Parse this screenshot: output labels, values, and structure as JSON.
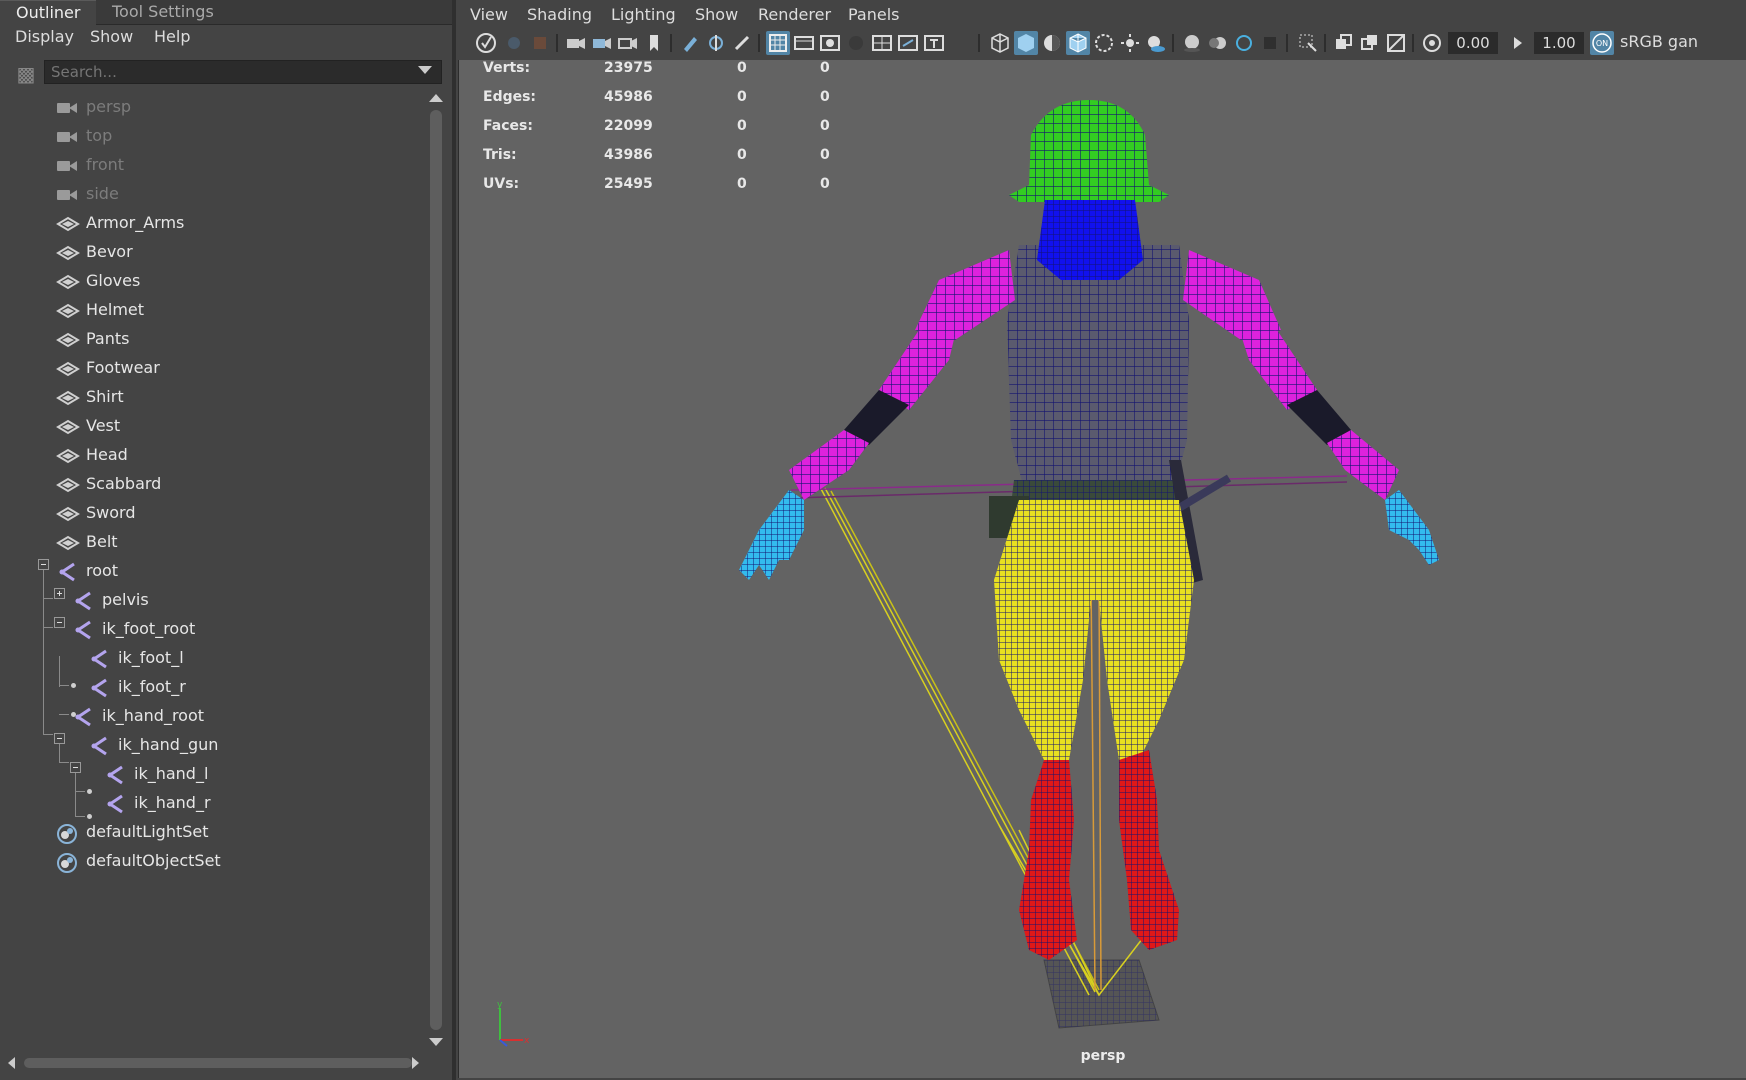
{
  "outliner": {
    "tabs": [
      "Outliner",
      "Tool Settings"
    ],
    "menu": [
      "Display",
      "Show",
      "Help"
    ],
    "search_placeholder": "Search...",
    "tree": [
      {
        "label": "persp",
        "icon": "camera-icon"
      },
      {
        "label": "top",
        "icon": "camera-icon"
      },
      {
        "label": "front",
        "icon": "camera-icon"
      },
      {
        "label": "side",
        "icon": "camera-icon"
      },
      {
        "label": "Armor_Arms",
        "icon": "mesh-icon"
      },
      {
        "label": "Bevor",
        "icon": "mesh-icon"
      },
      {
        "label": "Gloves",
        "icon": "mesh-icon"
      },
      {
        "label": "Helmet",
        "icon": "mesh-icon"
      },
      {
        "label": "Pants",
        "icon": "mesh-icon"
      },
      {
        "label": "Footwear",
        "icon": "mesh-icon"
      },
      {
        "label": "Shirt",
        "icon": "mesh-icon"
      },
      {
        "label": "Vest",
        "icon": "mesh-icon"
      },
      {
        "label": "Head",
        "icon": "mesh-icon"
      },
      {
        "label": "Scabbard",
        "icon": "mesh-icon"
      },
      {
        "label": "Sword",
        "icon": "mesh-icon"
      },
      {
        "label": "Belt",
        "icon": "mesh-icon"
      },
      {
        "label": "root",
        "icon": "joint-icon"
      },
      {
        "label": "pelvis",
        "icon": "joint-icon"
      },
      {
        "label": "ik_foot_root",
        "icon": "joint-icon"
      },
      {
        "label": "ik_foot_l",
        "icon": "joint-icon"
      },
      {
        "label": "ik_foot_r",
        "icon": "joint-icon"
      },
      {
        "label": "ik_hand_root",
        "icon": "joint-icon"
      },
      {
        "label": "ik_hand_gun",
        "icon": "joint-icon"
      },
      {
        "label": "ik_hand_l",
        "icon": "joint-icon"
      },
      {
        "label": "ik_hand_r",
        "icon": "joint-icon"
      },
      {
        "label": "defaultLightSet",
        "icon": "set-icon"
      },
      {
        "label": "defaultObjectSet",
        "icon": "set-icon"
      }
    ]
  },
  "viewport": {
    "menu": [
      "View",
      "Shading",
      "Lighting",
      "Show",
      "Renderer",
      "Panels"
    ],
    "toolbar": {
      "exposure": "0.00",
      "gamma": "1.00",
      "color_space": "sRGB gan"
    },
    "hud": [
      {
        "label": "Verts:",
        "v1": "23975",
        "v2": "0",
        "v3": "0"
      },
      {
        "label": "Edges:",
        "v1": "45986",
        "v2": "0",
        "v3": "0"
      },
      {
        "label": "Faces:",
        "v1": "22099",
        "v2": "0",
        "v3": "0"
      },
      {
        "label": "Tris:",
        "v1": "43986",
        "v2": "0",
        "v3": "0"
      },
      {
        "label": "UVs:",
        "v1": "25495",
        "v2": "0",
        "v3": "0"
      }
    ],
    "camera_label": "persp",
    "axis": {
      "y": "y",
      "x": "x"
    },
    "colors": {
      "helmet": "#33cc22",
      "bevor": "#1111ee",
      "armor_arms": "#dd22dd",
      "gloves": "#33bbee",
      "pants": "#e8e020",
      "footwear": "#e01818",
      "vest": "#5a5a6e",
      "wireframe": "#141470"
    }
  }
}
